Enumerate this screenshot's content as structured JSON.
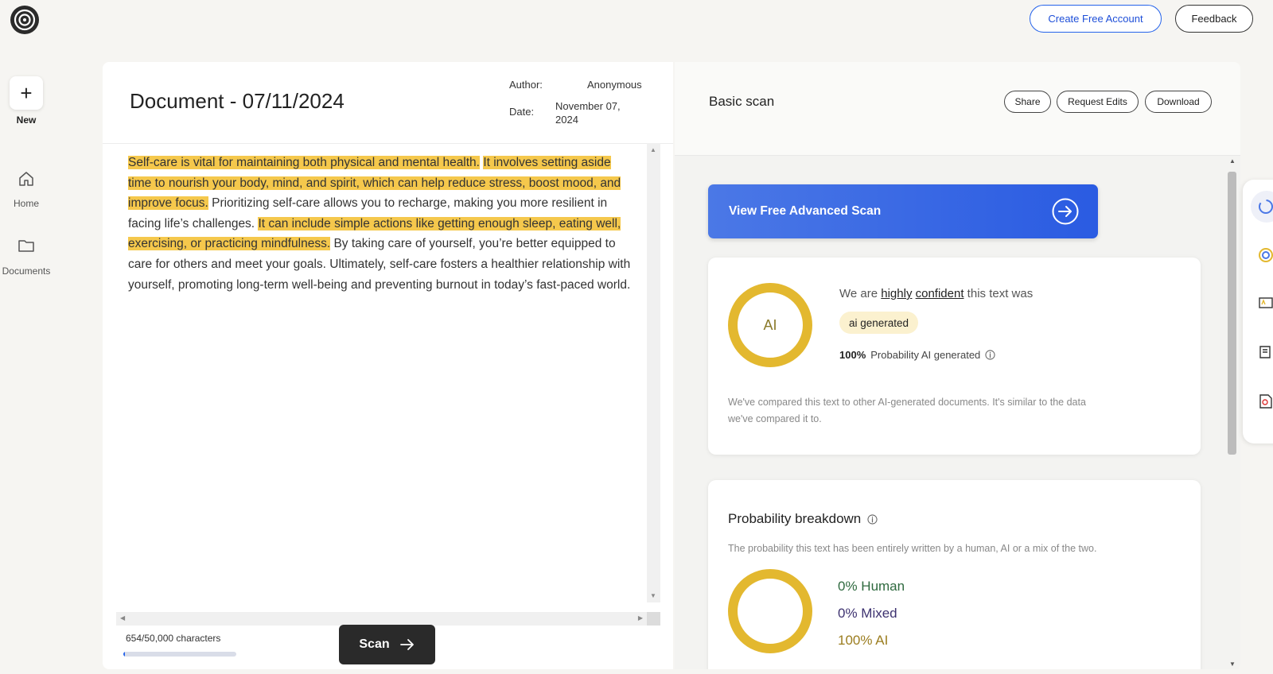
{
  "header": {
    "create_account_label": "Create Free Account",
    "feedback_label": "Feedback"
  },
  "sidebar": {
    "new_label": "New",
    "items": [
      {
        "label": "Home",
        "icon": "home-icon"
      },
      {
        "label": "Documents",
        "icon": "folder-icon"
      }
    ]
  },
  "document": {
    "title": "Document - 07/11/2024",
    "author_label": "Author:",
    "author_value": "Anonymous",
    "date_label": "Date:",
    "date_value": "November 07, 2024",
    "segments": [
      {
        "text": "Self-care is vital for maintaining both physical and mental health.",
        "highlight": true
      },
      {
        "text": " ",
        "highlight": false
      },
      {
        "text": "It involves setting aside time to nourish your body, mind, and spirit, which can help reduce stress, boost mood, and improve focus.",
        "highlight": true
      },
      {
        "text": " Prioritizing self-care allows you to recharge, making you more resilient in facing life’s challenges. ",
        "highlight": false
      },
      {
        "text": "It can include simple actions like getting enough sleep, eating well, exercising, or practicing mindfulness.",
        "highlight": true
      },
      {
        "text": " By taking care of yourself, you’re better equipped to care for others and meet your goals. Ultimately, self-care fosters a healthier relationship with yourself, promoting long-term well-being and preventing burnout in today’s fast-paced world.",
        "highlight": false
      }
    ],
    "char_count": "654/50,000 characters",
    "char_progress": 0.013,
    "scan_label": "Scan"
  },
  "results": {
    "title": "Basic scan",
    "share_label": "Share",
    "request_edits_label": "Request Edits",
    "download_label": "Download",
    "advanced_scan_label": "View Free Advanced Scan",
    "confidence": {
      "ring_label": "AI",
      "prefix": "We are ",
      "highly": "highly",
      "confident": "confident",
      "suffix": " this text was",
      "badge": "ai generated",
      "probability_value": "100%",
      "probability_text": "Probability AI generated",
      "note": "We've compared this text to other AI-generated documents. It's similar to the data we've compared it to."
    },
    "breakdown": {
      "title": "Probability breakdown",
      "subtitle": "The probability this text has been entirely written by a human, AI or a mix of the two.",
      "human": "0% Human",
      "mixed": "0% Mixed",
      "ai": "100% AI"
    }
  },
  "colors": {
    "accent_blue": "#2563eb",
    "highlight_yellow": "#f5c84c",
    "ring_gold": "#e3b82f",
    "human_green": "#2f6a3f",
    "mixed_purple": "#3d3270",
    "ai_gold": "#9b7d1f"
  },
  "icons": [
    "app-logo-icon",
    "plus-icon",
    "home-icon",
    "folder-icon",
    "arrow-right-icon",
    "arrow-circle-right-icon",
    "info-icon",
    "scan-tool-icon",
    "plagiarism-tool-icon",
    "grammar-tool-icon",
    "edit-tool-icon",
    "search-doc-tool-icon"
  ]
}
